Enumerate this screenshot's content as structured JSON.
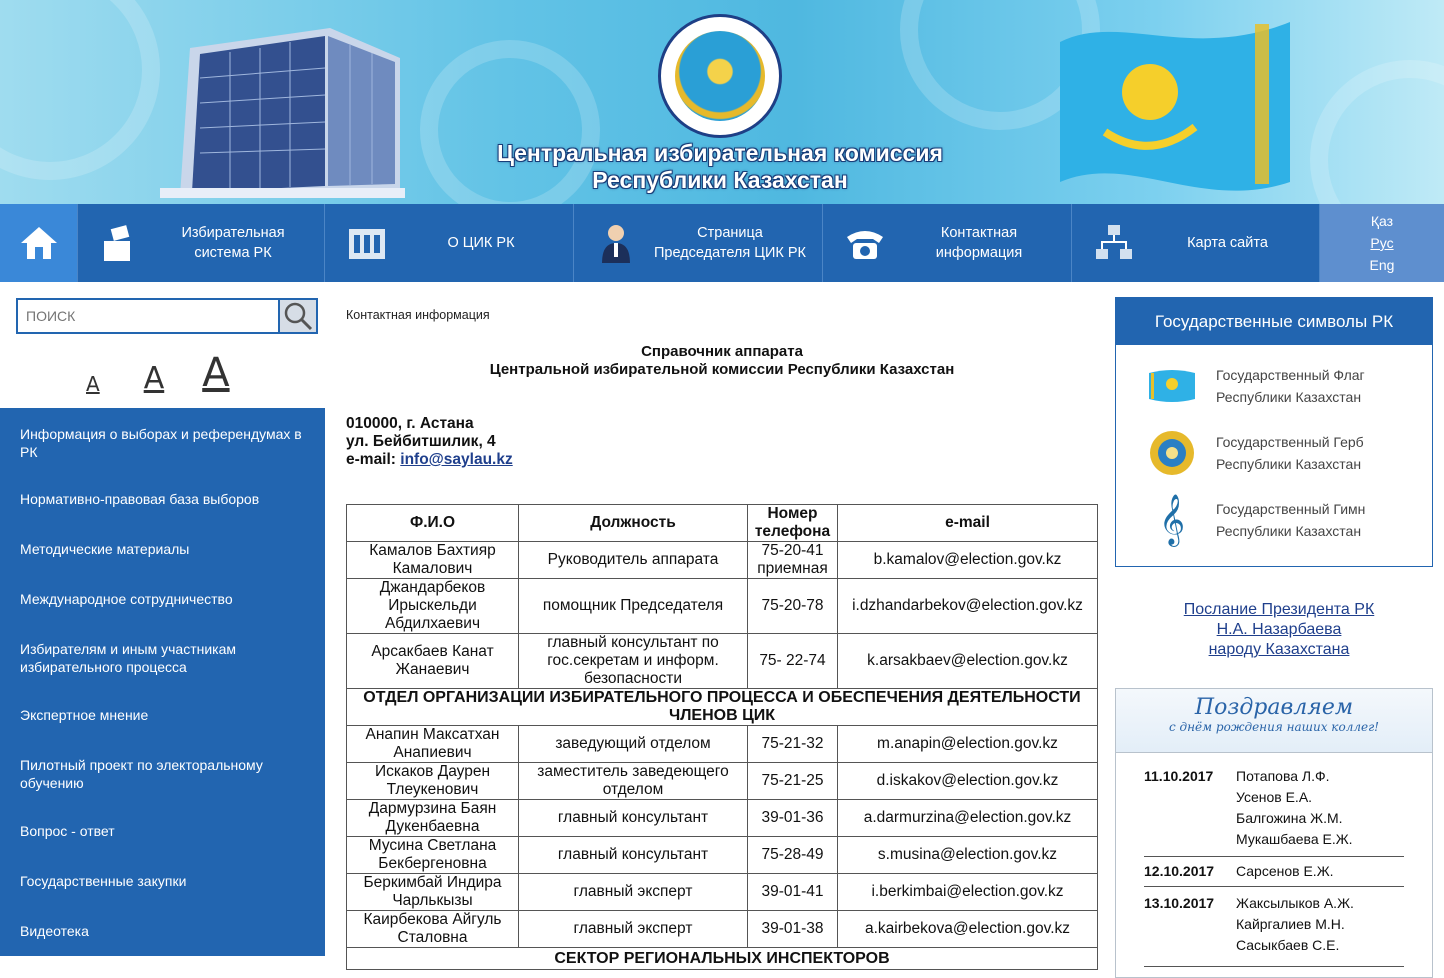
{
  "header": {
    "title_line1": "Центральная избирательная комиссия",
    "title_line2": "Республики Казахстан"
  },
  "nav": {
    "items": [
      {
        "label": "Избирательная система РК"
      },
      {
        "label": "О ЦИК РК"
      },
      {
        "label": "Страница Председателя ЦИК РК"
      },
      {
        "label": "Контактная информация"
      },
      {
        "label": "Карта сайта"
      }
    ],
    "lang": {
      "kaz": "Қаз",
      "rus": "Рус",
      "eng": "Eng"
    }
  },
  "search": {
    "placeholder": "ПОИСК"
  },
  "font_sizes": {
    "small": "A",
    "medium": "A",
    "large": "A"
  },
  "sidemenu": [
    "Информация о выборах и референдумах в РК",
    "Нормативно-правовая база выборов",
    "Методические материалы",
    "Международное сотрудничество",
    "Избирателям и иным участникам избирательного процесса",
    "Экспертное мнение",
    "Пилотный проект по электоральному обучению",
    "Вопрос - ответ",
    "Государственные закупки",
    "Видеотека"
  ],
  "breadcrumb": "Контактная информация",
  "doc": {
    "title_line1": "Справочник аппарата",
    "title_line2": "Центральной избирательной комиссии Республики Казахстан",
    "address_line1": "010000, г. Астана",
    "address_line2": "ул. Бейбитшилик, 4",
    "email_label": "e-mail: ",
    "email": "info@saylau.kz"
  },
  "table": {
    "headers": [
      "Ф.И.О",
      "Должность",
      "Номер телефона",
      "e-mail"
    ],
    "rows": [
      [
        "Камалов Бахтияр Камалович",
        "Руководитель аппарата",
        "75-20-41 приемная",
        "b.kamalov@election.gov.kz"
      ],
      [
        "Джандарбеков Ирыскельди Абдилхаевич",
        "помощник Председателя",
        "75-20-78",
        "i.dzhandarbekov@election.gov.kz"
      ],
      [
        "Арсакбаев Канат Жанаевич",
        "главный консультант по гос.секретам и информ. безопасности",
        "75- 22-74",
        "k.arsakbaev@election.gov.kz"
      ]
    ],
    "section1": "ОТДЕЛ ОРГАНИЗАЦИИ ИЗБИРАТЕЛЬНОГО ПРОЦЕССА И ОБЕСПЕЧЕНИЯ ДЕЯТЕЛЬНОСТИ ЧЛЕНОВ ЦИК",
    "rows2": [
      [
        "Анапин Максатхан Анапиевич",
        "заведующий отделом",
        "75-21-32",
        "m.anapin@election.gov.kz"
      ],
      [
        "Искаков Даурен Тлеукенович",
        "заместитель заведеющего отделом",
        "75-21-25",
        "d.iskakov@election.gov.kz"
      ],
      [
        "Дармурзина Баян Дукенбаевна",
        "главный консультант",
        "39-01-36",
        "a.darmurzina@election.gov.kz"
      ],
      [
        "Мусина Светлана Бекбергеновна",
        "главный консультант",
        "75-28-49",
        "s.musina@election.gov.kz"
      ],
      [
        "Беркимбай Индира Чарлькызы",
        "главный эксперт",
        "39-01-41",
        "i.berkimbai@election.gov.kz"
      ],
      [
        "Каирбекова Айгуль Сталовна",
        "главный эксперт",
        "39-01-38",
        "a.kairbekova@election.gov.kz"
      ]
    ],
    "section2": "СЕКТОР РЕГИОНАЛЬНЫХ ИНСПЕКТОРОВ"
  },
  "symbols": {
    "header": "Государственные символы РК",
    "items": [
      {
        "line1": "Государственный Флаг",
        "line2": "Республики Казахстан"
      },
      {
        "line1": "Государственный Герб",
        "line2": "Республики Казахстан"
      },
      {
        "line1": "Государственный Гимн",
        "line2": "Республики Казахстан"
      }
    ]
  },
  "message": {
    "line1": "Послание Президента РК",
    "line2": "Н.А. Назарбаева",
    "line3": "народу Казахстана"
  },
  "birthdays": {
    "banner_big": "Поздравляем",
    "banner_small": "с днём рождения наших коллег!",
    "entries": [
      {
        "date": "11.10.2017",
        "names": [
          "Потапова Л.Ф.",
          "Усенов Е.А.",
          "Балгожина Ж.М.",
          "Мукашбаева Е.Ж."
        ]
      },
      {
        "date": "12.10.2017",
        "names": [
          "Сарсенов Е.Ж."
        ]
      },
      {
        "date": "13.10.2017",
        "names": [
          "Жаксылыков А.Ж.",
          "Кайргалиев М.Н.",
          "Сасыкбаев С.Е."
        ]
      }
    ]
  },
  "colors": {
    "primary": "#2265b0",
    "accent": "#3a88d8",
    "lang_bg": "#5e8fcf"
  }
}
